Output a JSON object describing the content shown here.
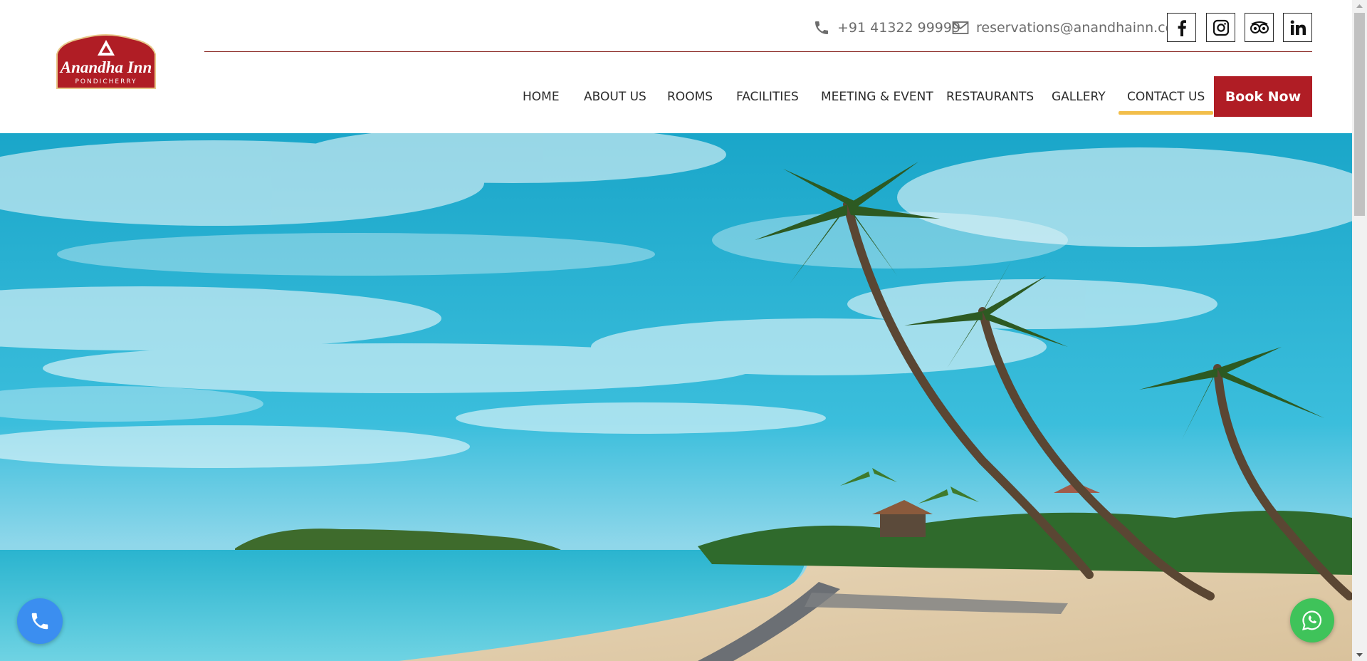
{
  "brand": {
    "name": "Anandha Inn",
    "location": "PONDICHERRY"
  },
  "contact": {
    "phone": "+91 41322 99999",
    "email": "reservations@anandhainn.com"
  },
  "social": [
    "facebook-icon",
    "instagram-icon",
    "tripadvisor-icon",
    "linkedin-icon"
  ],
  "nav": {
    "items": [
      "HOME",
      "ABOUT US",
      "ROOMS",
      "FACILITIES",
      "MEETING & EVENT",
      "RESTAURANTS",
      "GALLERY",
      "CONTACT US"
    ],
    "active": "CONTACT US"
  },
  "cta": {
    "book_label": "Book Now"
  },
  "hero": {
    "description": "tropical beach with palm trees"
  },
  "colors": {
    "brand_red": "#b01d25",
    "active_underline": "#f2be4a",
    "divider": "#8b2a25",
    "call_button": "#3b8ef0",
    "whatsapp_button": "#3fc35a"
  }
}
